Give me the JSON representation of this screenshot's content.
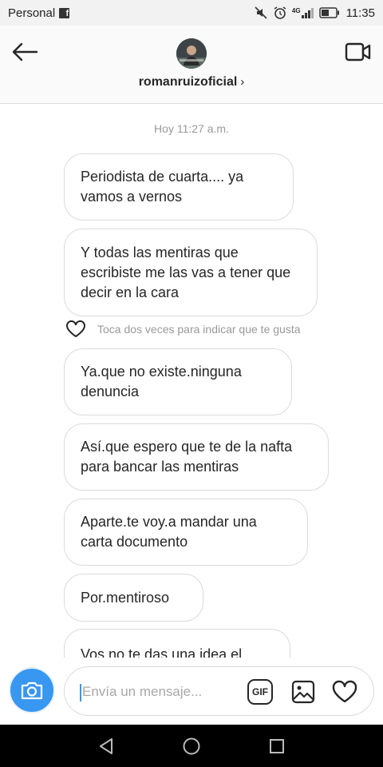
{
  "status_bar": {
    "carrier": "Personal",
    "app_badge": "f",
    "network": "4G",
    "time": "11:35",
    "icons": [
      "facebook-icon",
      "mute-icon",
      "alarm-icon",
      "signal-icon",
      "battery-icon"
    ]
  },
  "header": {
    "username": "romanruizoficial",
    "chevron": "›",
    "icons": [
      "back-arrow-icon",
      "video-call-icon"
    ]
  },
  "chat": {
    "timestamp": "Hoy 11:27 a.m.",
    "like_hint": "Toca dos veces para indicar que te gusta",
    "messages": [
      {
        "text": "Periodista de cuarta.... ya vamos a vernos"
      },
      {
        "text": "Y todas las mentiras que escribiste me las vas a tener que decir en la cara"
      },
      {
        "text": "Ya.que no existe.ninguna denuncia"
      },
      {
        "text": "Así.que espero que te de la nafta para bancar las mentiras"
      },
      {
        "text": "Aparte.te voy.a mandar una carta documento"
      },
      {
        "text": "Por.mentiroso"
      },
      {
        "text": "Vos no te das una idea el"
      }
    ]
  },
  "composer": {
    "placeholder": "Envía un mensaje...",
    "gif_label": "GIF",
    "icons": [
      "camera-icon",
      "gallery-icon",
      "heart-icon"
    ]
  },
  "nav_bar": {
    "icons": [
      "back-triangle-icon",
      "home-circle-icon",
      "recents-square-icon"
    ]
  },
  "colors": {
    "accent": "#3897f0",
    "bubble_border": "#dbdbdb",
    "muted_text": "#999999"
  }
}
